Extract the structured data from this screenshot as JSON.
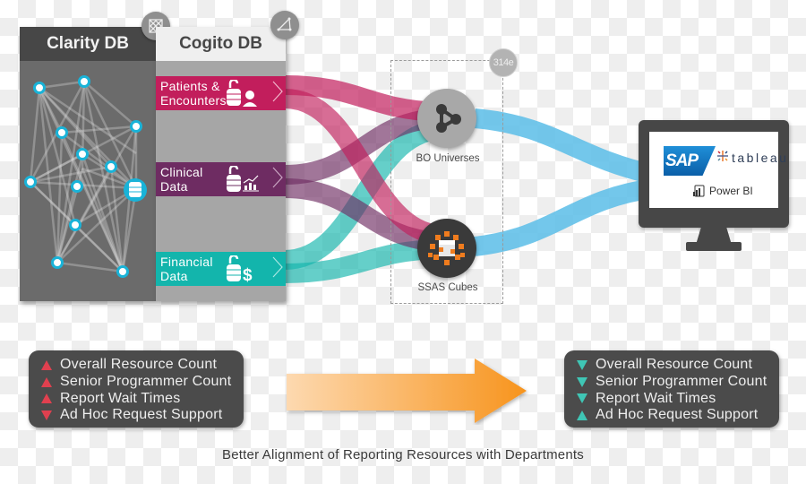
{
  "sources_panel": {
    "clarity_title": "Clarity DB",
    "cogito_title": "Cogito DB",
    "clarity_badge_icon": "network-mesh-icon",
    "cogito_badge_icon": "triangle-network-icon",
    "clarity_hub_icon": "database-icon"
  },
  "data_sources": [
    {
      "label": "Patients &\nEncounters",
      "icon": "database-unlock-person-icon",
      "color": "#c21e5c"
    },
    {
      "label": "Clinical\nData",
      "icon": "database-unlock-chart-icon",
      "color": "#6e2c62"
    },
    {
      "label": "Financial\nData",
      "icon": "database-unlock-dollar-icon",
      "color": "#13b5ac"
    }
  ],
  "semantic_layer": {
    "badge_text": "314e",
    "nodes": [
      {
        "label": "BO Universes",
        "icon": "share-graph-icon"
      },
      {
        "label": "SSAS Cubes",
        "icon": "cube-cluster-icon"
      }
    ]
  },
  "destination": {
    "icon": "monitor-icon",
    "tools": [
      "SAP",
      "tableau",
      "Power BI"
    ]
  },
  "flow_colors": {
    "patients": "#c21e5c",
    "clinical": "#6e2c62",
    "financial": "#13b5ac",
    "output": "#5bbde8"
  },
  "before": {
    "items": [
      {
        "label": "Overall Resource Count",
        "trend": "up"
      },
      {
        "label": "Senior Programmer Count",
        "trend": "up"
      },
      {
        "label": "Report Wait Times",
        "trend": "up"
      },
      {
        "label": "Ad Hoc Request Support",
        "trend": "down"
      }
    ],
    "color": "#e0404f"
  },
  "after": {
    "items": [
      {
        "label": "Overall Resource Count",
        "trend": "down"
      },
      {
        "label": "Senior Programmer Count",
        "trend": "down"
      },
      {
        "label": "Report Wait Times",
        "trend": "down"
      },
      {
        "label": "Ad Hoc Request Support",
        "trend": "up"
      }
    ],
    "color": "#3fc6b5"
  },
  "caption": "Better Alignment of Reporting Resources with Departments"
}
